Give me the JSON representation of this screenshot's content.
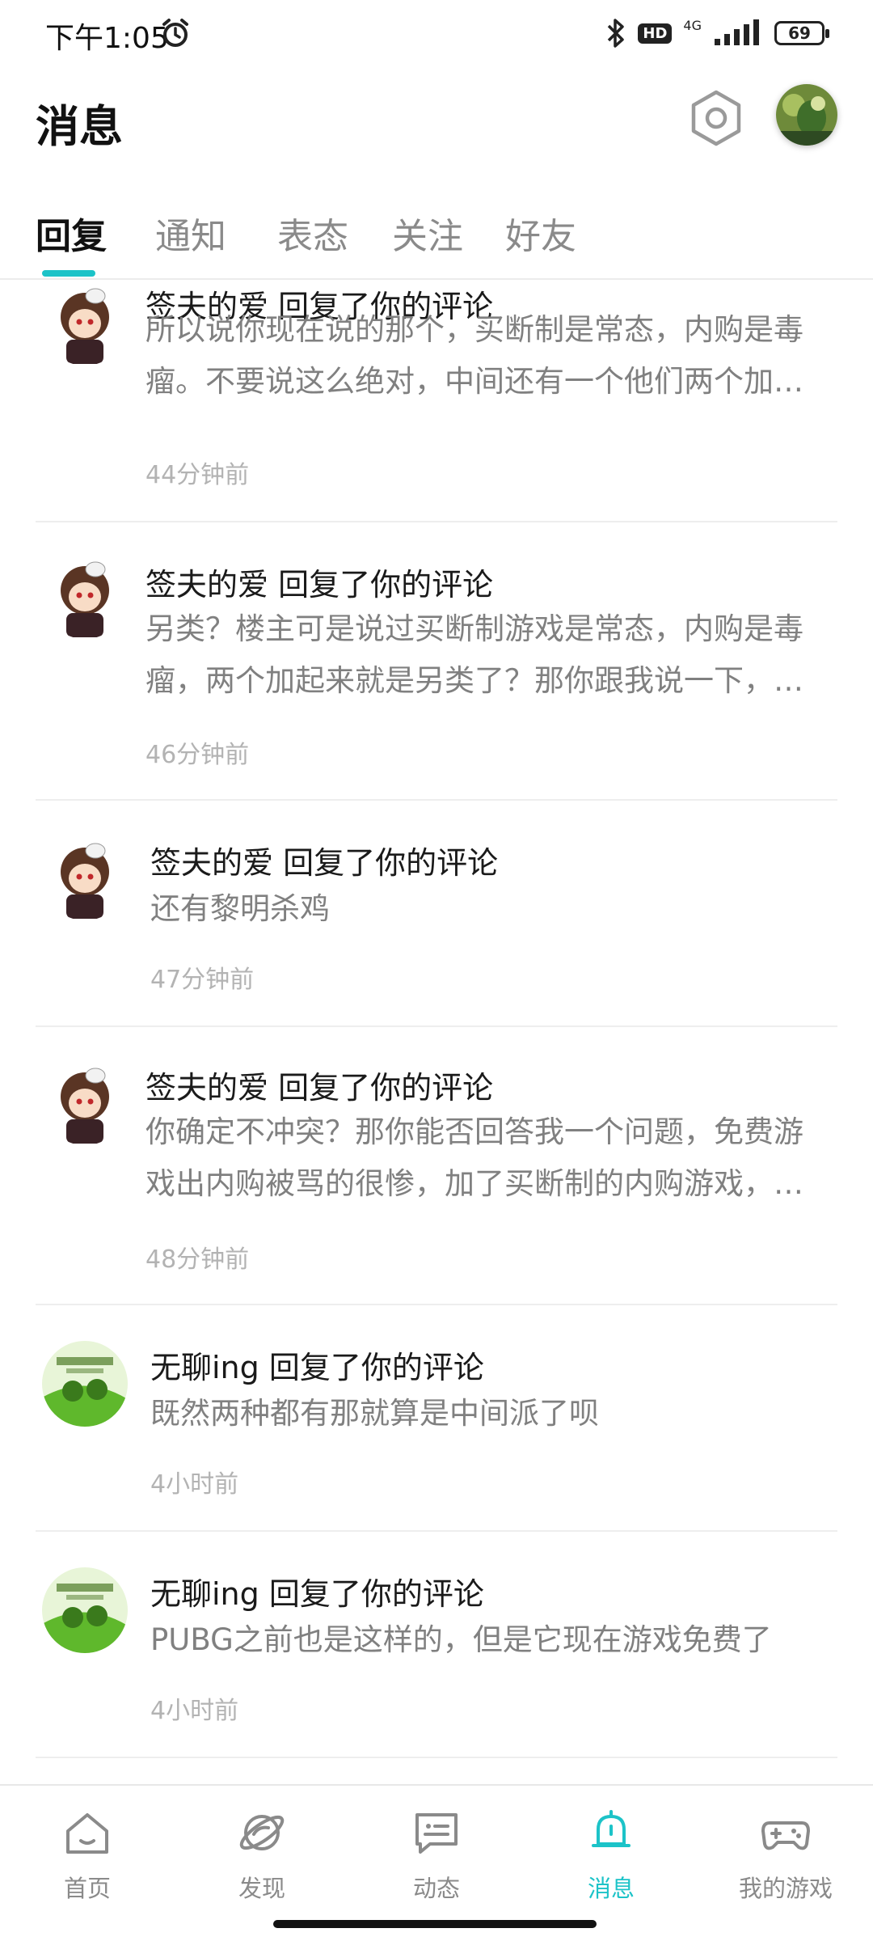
{
  "status_bar": {
    "time": "下午1:05",
    "hd": "HD",
    "network": "4G",
    "battery": "69"
  },
  "header": {
    "title": "消息"
  },
  "tabs": [
    {
      "label": "回复",
      "active": true
    },
    {
      "label": "通知",
      "active": false
    },
    {
      "label": "表态",
      "active": false
    },
    {
      "label": "关注",
      "active": false
    },
    {
      "label": "好友",
      "active": false
    }
  ],
  "messages": [
    {
      "user": "签夫的爱",
      "action": "回复了你的评论",
      "title": "签夫的爱 回复了你的评论",
      "lines": [
        "所以说你现在说的那个，买断制是常态，内购是毒",
        "瘤。不要说这么绝对，中间还有一个他们两个加…"
      ],
      "time": "44分钟前",
      "avatar": "anime-girl"
    },
    {
      "user": "签夫的爱",
      "action": "回复了你的评论",
      "title": "签夫的爱 回复了你的评论",
      "lines": [
        "另类？楼主可是说过买断制游戏是常态，内购是毒",
        "瘤，两个加起来就是另类了？那你跟我说一下，…"
      ],
      "time": "46分钟前",
      "avatar": "anime-girl"
    },
    {
      "user": "签夫的爱",
      "action": "回复了你的评论",
      "title": "签夫的爱 回复了你的评论",
      "lines": [
        "还有黎明杀鸡"
      ],
      "time": "47分钟前",
      "avatar": "anime-girl"
    },
    {
      "user": "签夫的爱",
      "action": "回复了你的评论",
      "title": "签夫的爱 回复了你的评论",
      "lines": [
        "你确定不冲突？那你能否回答我一个问题，免费游",
        "戏出内购被骂的很惨，加了买断制的内购游戏，…"
      ],
      "time": "48分钟前",
      "avatar": "anime-girl"
    },
    {
      "user": "无聊ing",
      "action": "回复了你的评论",
      "title": "无聊ing 回复了你的评论",
      "lines": [
        "既然两种都有那就算是中间派了呗"
      ],
      "time": "4小时前",
      "avatar": "green-meme"
    },
    {
      "user": "无聊ing",
      "action": "回复了你的评论",
      "title": "无聊ing 回复了你的评论",
      "lines": [
        "PUBG之前也是这样的，但是它现在游戏免费了"
      ],
      "time": "4小时前",
      "avatar": "green-meme"
    }
  ],
  "bottom_nav": [
    {
      "label": "首页",
      "icon": "home-icon",
      "active": false
    },
    {
      "label": "发现",
      "icon": "planet-icon",
      "active": false
    },
    {
      "label": "动态",
      "icon": "chat-icon",
      "active": false
    },
    {
      "label": "消息",
      "icon": "bell-icon",
      "active": true
    },
    {
      "label": "我的游戏",
      "icon": "gamepad-icon",
      "active": false
    }
  ],
  "colors": {
    "accent": "#1cc3c8",
    "text": "#1a1a1a",
    "muted": "#808080",
    "time": "#b3b3b3"
  }
}
